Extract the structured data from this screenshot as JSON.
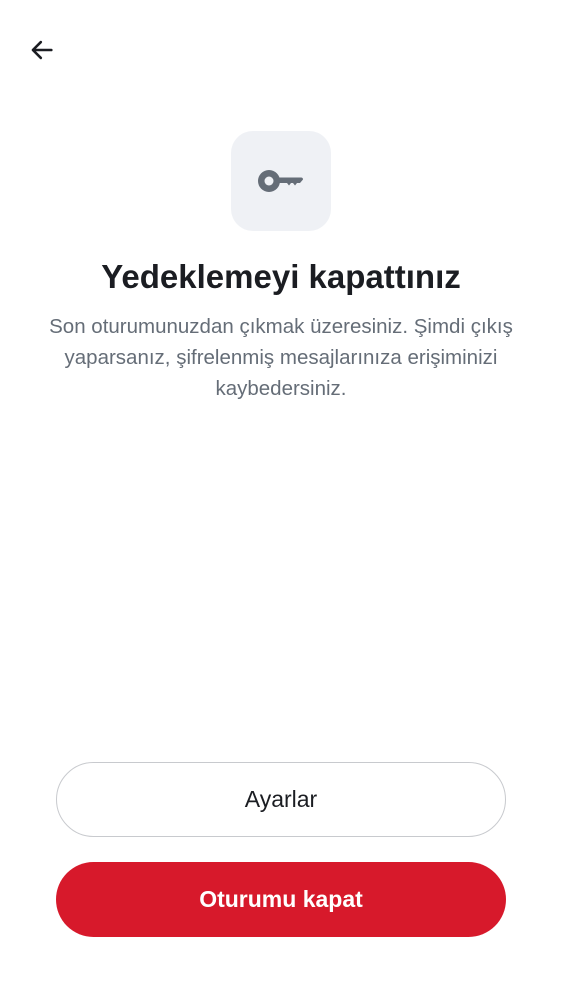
{
  "header": {
    "back_icon": "arrow-left-icon"
  },
  "hero": {
    "icon": "key-icon",
    "title": "Yedeklemeyi kapattınız",
    "description": "Son oturumunuzdan çıkmak üzeresiniz. Şimdi çıkış yaparsanız, şifrelenmiş mesajlarınıza erişiminizi kaybedersiniz."
  },
  "actions": {
    "settings_label": "Ayarlar",
    "signout_label": "Oturumu kapat"
  },
  "colors": {
    "primary": "#d7192b",
    "icon_tile_bg": "#eff1f5",
    "icon_color": "#656d77",
    "title_text": "#1b1d22",
    "body_text": "#656d77"
  }
}
